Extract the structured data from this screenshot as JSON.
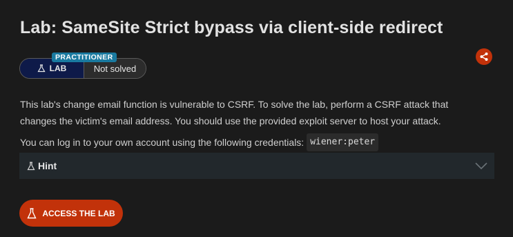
{
  "lab": {
    "title": "Lab: SameSite Strict bypass via client-side redirect",
    "level_tag": "PRACTITIONER",
    "badge_label": "LAB",
    "status": "Not solved"
  },
  "description": {
    "paragraph": "This lab's change email function is vulnerable to CSRF. To solve the lab, perform a CSRF attack that changes the victim's email address. You should use the provided exploit server to host your attack.",
    "credentials_text": "You can log in to your own account using the following credentials:",
    "credentials_code": "wiener:peter"
  },
  "hint": {
    "label": "Hint"
  },
  "actions": {
    "access_label": "ACCESS THE LAB"
  },
  "icons": {
    "share": "share-icon",
    "flask": "flask-icon",
    "chevron": "chevron-down-icon"
  },
  "colors": {
    "accent": "#c2320a",
    "lab_badge_bg": "#0e1a49",
    "practitioner_tag": "#1a7aa0",
    "hint_bg": "#22282c"
  }
}
